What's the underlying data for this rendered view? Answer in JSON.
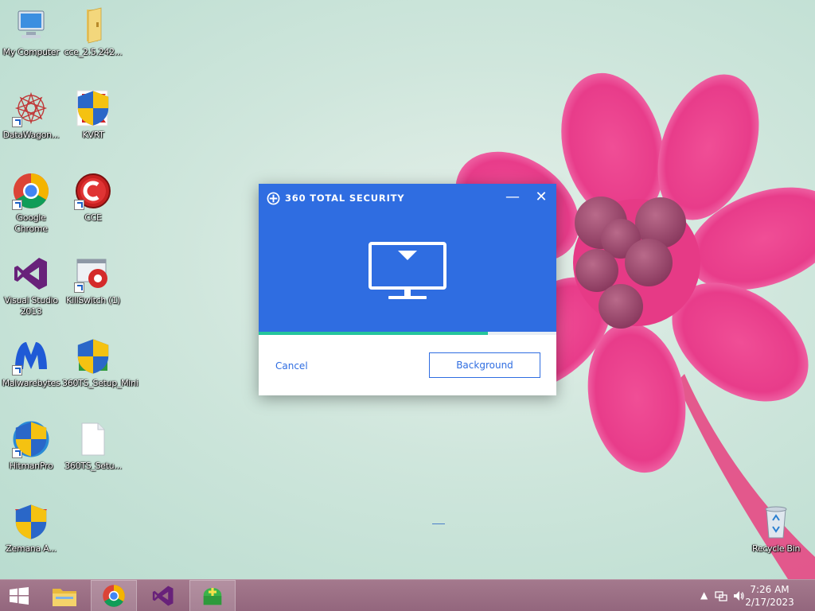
{
  "desktop": {
    "icons": [
      {
        "label": "My Computer"
      },
      {
        "label": "cce_2.5.242..."
      },
      {
        "label": "DataWagon..."
      },
      {
        "label": "KVRT"
      },
      {
        "label": "Google Chrome"
      },
      {
        "label": "CCE"
      },
      {
        "label": "Visual Studio 2013"
      },
      {
        "label": "KillSwitch (1)"
      },
      {
        "label": "Malwarebytes"
      },
      {
        "label": "360TS_Setup_Mini"
      },
      {
        "label": "HitmanPro"
      },
      {
        "label": "360TS_Setu..."
      },
      {
        "label": "Zemana A..."
      },
      {
        "label": "Recycle Bin"
      }
    ]
  },
  "dialog": {
    "title": "360 TOTAL SECURITY",
    "minimize_label": "—",
    "close_label": "✕",
    "progress": 0.77,
    "cancel_label": "Cancel",
    "background_label": "Background"
  },
  "taskbar": {
    "apps": [
      "file-explorer",
      "google-chrome",
      "visual-studio",
      "360-total-security-setup"
    ],
    "clock": {
      "time": "7:26 AM",
      "date": "2/17/2023"
    }
  },
  "colors": {
    "accent": "#2f6de1",
    "progress": "#25c59c",
    "taskbar": "#9a6e84"
  }
}
